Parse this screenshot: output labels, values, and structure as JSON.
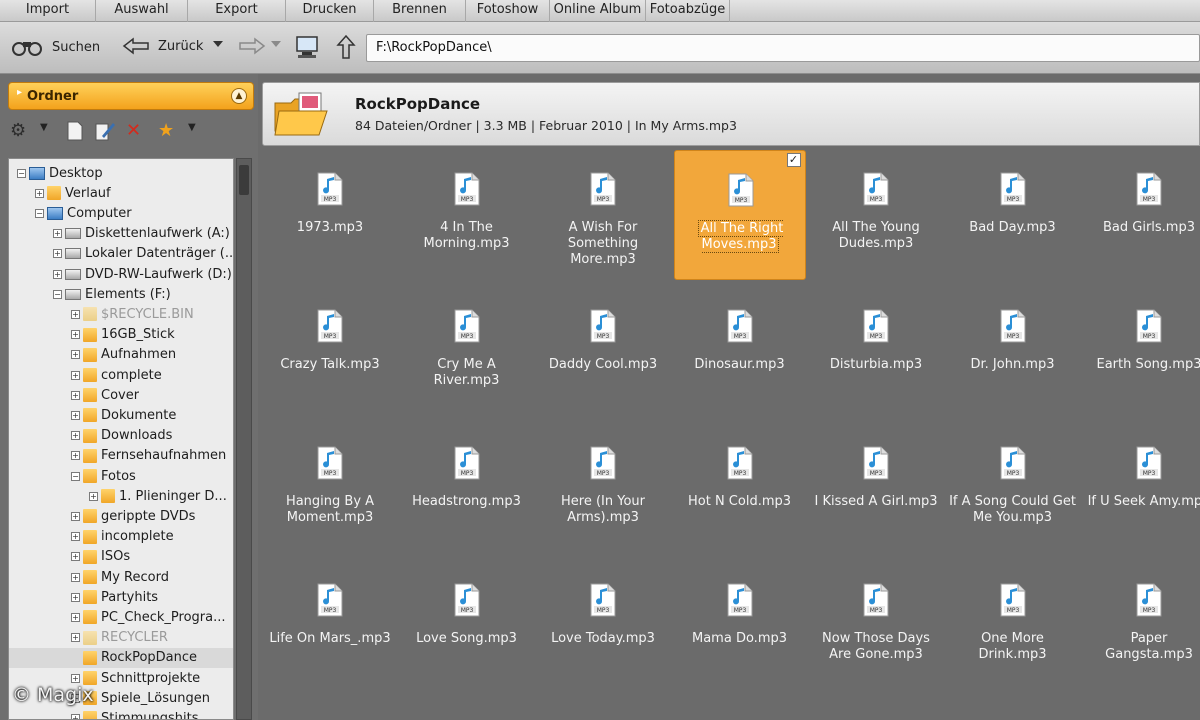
{
  "tabs": [
    "Import",
    "Auswahl",
    "Export",
    "Drucken",
    "Brennen",
    "Fotoshow",
    "Online Album",
    "Fotoabzüge"
  ],
  "toolbar": {
    "search_label": "Suchen",
    "back_label": "Zurück",
    "address": "F:\\RockPopDance\\"
  },
  "sidebar": {
    "panel_title": "Ordner",
    "tree": [
      {
        "label": "Desktop",
        "indent": 0,
        "icon": "desktop-icon",
        "expander": "minus"
      },
      {
        "label": "Verlauf",
        "indent": 1,
        "icon": "folder-icon",
        "expander": "plus"
      },
      {
        "label": "Computer",
        "indent": 1,
        "icon": "computer-icon",
        "expander": "minus"
      },
      {
        "label": "Diskettenlaufwerk (A:)",
        "indent": 2,
        "icon": "drive-icon",
        "expander": "plus"
      },
      {
        "label": "Lokaler Datenträger (...",
        "indent": 2,
        "icon": "drive-icon",
        "expander": "plus"
      },
      {
        "label": "DVD-RW-Laufwerk (D:)",
        "indent": 2,
        "icon": "drive-icon",
        "expander": "plus"
      },
      {
        "label": "Elements (F:)",
        "indent": 2,
        "icon": "drive-icon",
        "expander": "minus"
      },
      {
        "label": "$RECYCLE.BIN",
        "indent": 3,
        "icon": "folder-icon",
        "expander": "plus",
        "dim": true
      },
      {
        "label": "16GB_Stick",
        "indent": 3,
        "icon": "folder-icon",
        "expander": "plus"
      },
      {
        "label": "Aufnahmen",
        "indent": 3,
        "icon": "folder-icon",
        "expander": "plus"
      },
      {
        "label": "complete",
        "indent": 3,
        "icon": "folder-icon",
        "expander": "plus"
      },
      {
        "label": "Cover",
        "indent": 3,
        "icon": "folder-icon",
        "expander": "plus"
      },
      {
        "label": "Dokumente",
        "indent": 3,
        "icon": "folder-icon",
        "expander": "plus"
      },
      {
        "label": "Downloads",
        "indent": 3,
        "icon": "folder-icon",
        "expander": "plus"
      },
      {
        "label": "Fernsehaufnahmen",
        "indent": 3,
        "icon": "folder-icon",
        "expander": "plus"
      },
      {
        "label": "Fotos",
        "indent": 3,
        "icon": "folder-icon",
        "expander": "minus"
      },
      {
        "label": "1. Plieninger D...",
        "indent": 4,
        "icon": "folder-icon",
        "expander": "plus"
      },
      {
        "label": "gerippte DVDs",
        "indent": 3,
        "icon": "folder-icon",
        "expander": "plus"
      },
      {
        "label": "incomplete",
        "indent": 3,
        "icon": "folder-icon",
        "expander": "plus"
      },
      {
        "label": "ISOs",
        "indent": 3,
        "icon": "folder-icon",
        "expander": "plus"
      },
      {
        "label": "My Record",
        "indent": 3,
        "icon": "folder-icon",
        "expander": "plus"
      },
      {
        "label": "Partyhits",
        "indent": 3,
        "icon": "folder-icon",
        "expander": "plus"
      },
      {
        "label": "PC_Check_Progra...",
        "indent": 3,
        "icon": "folder-icon",
        "expander": "plus"
      },
      {
        "label": "RECYCLER",
        "indent": 3,
        "icon": "folder-icon",
        "expander": "plus",
        "dim": true
      },
      {
        "label": "RockPopDance",
        "indent": 3,
        "icon": "folder-icon",
        "expander": "none",
        "selected": true
      },
      {
        "label": "Schnittprojekte",
        "indent": 3,
        "icon": "folder-icon",
        "expander": "plus"
      },
      {
        "label": "Spiele_Lösungen",
        "indent": 3,
        "icon": "folder-icon",
        "expander": "plus"
      },
      {
        "label": "Stimmungshits",
        "indent": 3,
        "icon": "folder-icon",
        "expander": "plus"
      }
    ]
  },
  "content": {
    "folder_name": "RockPopDance",
    "folder_info": "84 Dateien/Ordner | 3.3 MB | Februar 2010 | In My Arms.mp3",
    "files": [
      {
        "name": "1973.mp3"
      },
      {
        "name": "4 In The Morning.mp3"
      },
      {
        "name": "A Wish For Something More.mp3"
      },
      {
        "name": "All The Right Moves.mp3",
        "selected": true
      },
      {
        "name": "All The Young Dudes.mp3"
      },
      {
        "name": "Bad Day.mp3"
      },
      {
        "name": "Bad Girls.mp3"
      },
      {
        "name": "Crazy Talk.mp3"
      },
      {
        "name": "Cry Me A River.mp3"
      },
      {
        "name": "Daddy Cool.mp3"
      },
      {
        "name": "Dinosaur.mp3"
      },
      {
        "name": "Disturbia.mp3"
      },
      {
        "name": "Dr. John.mp3"
      },
      {
        "name": "Earth Song.mp3"
      },
      {
        "name": "Hanging By A Moment.mp3"
      },
      {
        "name": "Headstrong.mp3"
      },
      {
        "name": "Here (In Your Arms).mp3"
      },
      {
        "name": "Hot N Cold.mp3"
      },
      {
        "name": "I Kissed A Girl.mp3"
      },
      {
        "name": "If A Song Could Get Me You.mp3"
      },
      {
        "name": "If U Seek Amy.mp3"
      },
      {
        "name": "Life On Mars_.mp3"
      },
      {
        "name": "Love Song.mp3"
      },
      {
        "name": "Love Today.mp3"
      },
      {
        "name": "Mama Do.mp3"
      },
      {
        "name": "Now Those Days Are Gone.mp3"
      },
      {
        "name": "One More Drink.mp3"
      },
      {
        "name": "Paper Gangsta.mp3"
      }
    ],
    "file_badge": "MP3"
  },
  "watermark": "© Magix",
  "colors": {
    "accent": "#f2a73b",
    "background": "#6b6b6b"
  }
}
